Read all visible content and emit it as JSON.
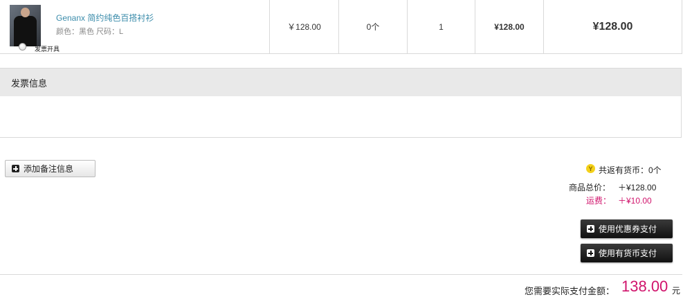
{
  "product": {
    "name": "Genanx 简约纯色百搭衬衫",
    "attributes": "颜色：黑色 尺码：L",
    "price": "￥128.00",
    "coins": "0个",
    "quantity": "1",
    "subtotal": "¥128.00",
    "total": "¥128.00"
  },
  "invoice": {
    "title": "发票信息",
    "option_label": "发票开具"
  },
  "note_button": "添加备注信息",
  "summary": {
    "coin_icon": "Y",
    "coins_text": "共返有货币：0个",
    "goods_label": "商品总价：",
    "goods_value": "＋¥128.00",
    "shipping_label": "运费：",
    "shipping_value": "＋¥10.00"
  },
  "actions": {
    "coupon": "使用优惠券支付",
    "currency": "使用有货币支付"
  },
  "payment": {
    "label": "您需要实际支付金额：",
    "amount": "138.00",
    "unit": "元"
  },
  "colors": {
    "accent": "#d0126b",
    "link": "#3b8cab"
  }
}
